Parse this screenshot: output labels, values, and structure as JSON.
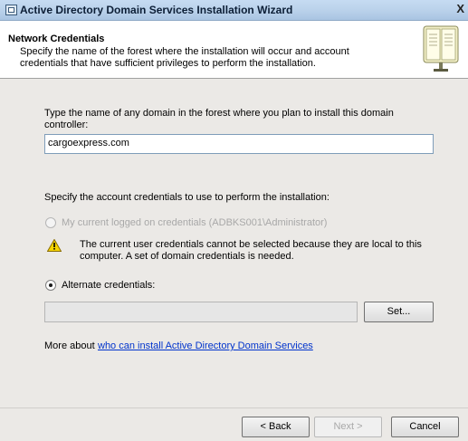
{
  "window": {
    "title": "Active Directory Domain Services Installation Wizard",
    "close_glyph": "X"
  },
  "header": {
    "title": "Network Credentials",
    "description": "Specify the name of the forest where the installation will occur and account credentials that have sufficient privileges to perform the installation.",
    "icon": "book-icon"
  },
  "domain": {
    "prompt": "Type the name of any domain in the forest where you plan to install this domain controller:",
    "value": "cargoexpress.com"
  },
  "credentials": {
    "prompt": "Specify the account credentials to use to perform the installation:",
    "current_option": {
      "label": "My current logged on credentials (ADBKS001\\Administrator)",
      "selected": false,
      "enabled": false
    },
    "warning": {
      "icon": "warning-icon",
      "text": "The current user credentials cannot be selected because they are local to this computer. A set of domain credentials is needed."
    },
    "alternate_option": {
      "label": "Alternate credentials:",
      "selected": true,
      "enabled": true
    },
    "alternate_value": "",
    "set_button": "Set..."
  },
  "more_about": {
    "prefix": "More about ",
    "link_text": "who can install Active Directory Domain Services"
  },
  "buttons": {
    "back": "< Back",
    "next": "Next >",
    "cancel": "Cancel"
  },
  "colors": {
    "titlebar": "#b9d1ea",
    "content_background": "#ebe9e6",
    "link": "#0033cc",
    "warning": "#f5d400"
  }
}
